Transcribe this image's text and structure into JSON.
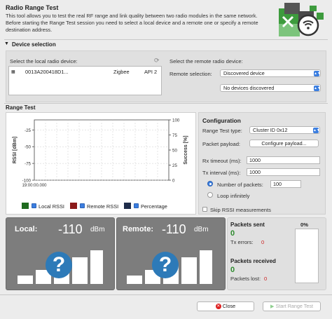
{
  "header": {
    "title": "Radio Range Test",
    "description": "This tool allows you to test the real RF range and link quality between two radio modules in the same network. Before starting the Range Test session you need to select a local device and a remote one or specify a remote destination address."
  },
  "device_selection": {
    "heading": "Device selection",
    "local_label": "Select the local radio device:",
    "local_device": {
      "id": "0013A200418D1...",
      "protocol": "Zigbee",
      "api": "API 2"
    },
    "remote_label": "Select the remote radio device:",
    "remote_selection_label": "Remote selection:",
    "remote_selection_value": "Discovered device",
    "remote_device_value": "No devices discovered"
  },
  "range_test": {
    "heading": "Range Test",
    "chart_data": {
      "type": "line",
      "ylabel_left": "RSSI [dBm]",
      "ylabel_right": "Success [%]",
      "ylim_left": [
        -100,
        -10
      ],
      "yticks_left": [
        "-25",
        "-50",
        "-75",
        "-100"
      ],
      "ylim_right": [
        0,
        100
      ],
      "yticks_right": [
        "100",
        "75",
        "50",
        "25",
        "0"
      ],
      "x": [
        "19:00:00.000"
      ],
      "series": [
        {
          "name": "Local RSSI",
          "values": []
        },
        {
          "name": "Remote RSSI",
          "values": []
        },
        {
          "name": "Percentage",
          "values": []
        }
      ],
      "grid": true,
      "colors": {
        "local": "#1f6b1f",
        "remote": "#8b1a1a",
        "percentage": "#1e2c4a"
      }
    },
    "legend": {
      "local": "Local RSSI",
      "remote": "Remote RSSI",
      "percentage": "Percentage"
    }
  },
  "configuration": {
    "heading": "Configuration",
    "type_label": "Range Test type:",
    "type_value": "Cluster ID 0x12",
    "payload_label": "Packet payload:",
    "payload_button": "Configure payload...",
    "rx_timeout_label": "Rx timeout (ms):",
    "rx_timeout_value": "1000",
    "tx_interval_label": "Tx interval (ms):",
    "tx_interval_value": "1000",
    "num_packets_label": "Number of packets:",
    "num_packets_value": "100",
    "loop_label": "Loop infinitely",
    "skip_rssi_label": "Skip RSSI measurements"
  },
  "local_panel": {
    "label": "Local:",
    "value": "-110",
    "unit": "dBm",
    "signal_level": 0
  },
  "remote_panel": {
    "label": "Remote:",
    "value": "-110",
    "unit": "dBm",
    "signal_level": 0
  },
  "packets": {
    "sent_label": "Packets sent",
    "sent_value": "0",
    "tx_errors_label": "Tx errors:",
    "tx_errors_value": "0",
    "received_label": "Packets received",
    "received_value": "0",
    "lost_label": "Packets lost:",
    "lost_value": "0",
    "percent": "0%",
    "progress_fraction": 0
  },
  "footer": {
    "close_label": "Close",
    "start_label": "Start Range Test"
  }
}
